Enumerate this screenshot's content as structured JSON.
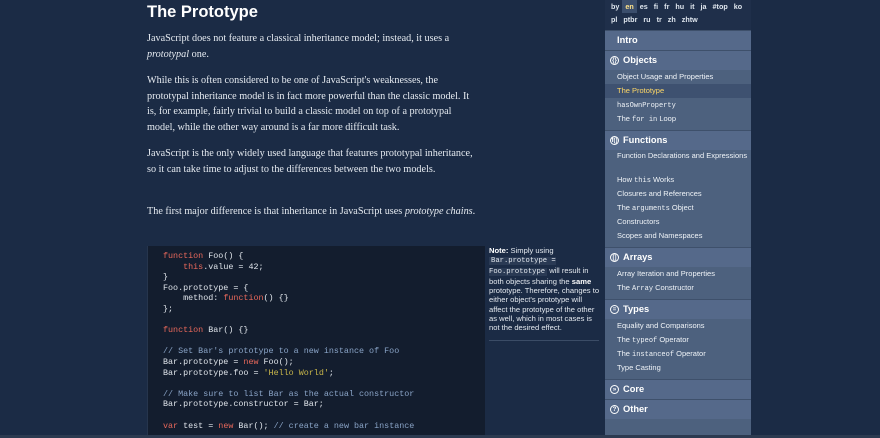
{
  "article": {
    "title": "The Prototype",
    "p1": [
      "JavaScript does not feature a classical inheritance model; instead, it uses a ",
      "prototypal",
      " one."
    ],
    "p2": "While this is often considered to be one of JavaScript's weaknesses, the prototypal inheritance model is in fact more powerful than the classic model. It is, for example, fairly trivial to build a classic model on top of a prototypal model, while the other way around is a far more difficult task.",
    "p3": "JavaScript is the only widely used language that features prototypal inheritance, so it can take time to adjust to the differences between the two models.",
    "p4": [
      "The first major difference is that inheritance in JavaScript uses ",
      "prototype chains",
      "."
    ]
  },
  "code_lines": [
    "function Foo() {",
    "    this.value = 42;",
    "}",
    "Foo.prototype = {",
    "    method: function() {}",
    "};",
    "",
    "function Bar() {}",
    "",
    "// Set Bar's prototype to a new instance of Foo",
    "Bar.prototype = new Foo();",
    "Bar.prototype.foo = 'Hello World';",
    "",
    "// Make sure to list Bar as the actual constructor",
    "Bar.prototype.constructor = Bar;",
    "",
    "var test = new Bar(); // create a new bar instance"
  ],
  "note": {
    "label": "Note:",
    "t1": " Simply using ",
    "c1": "Bar.prototype = Foo.prototype",
    "t2": " will result in both objects sharing the ",
    "b1": "same",
    "t3": " prototype. Therefore, changes to either object's prototype will affect the prototype of the other as well, which in most cases is not the desired effect."
  },
  "nav": {
    "languages": [
      "by",
      "en",
      "es",
      "fi",
      "fr",
      "hu",
      "it",
      "ja",
      "#top",
      "ko",
      "pl",
      "ptbr",
      "ru",
      "tr",
      "zh",
      "zhtw"
    ],
    "active_language": "en",
    "intro": "Intro",
    "sections": [
      {
        "title": "Objects",
        "icon": "objects-icon",
        "glyph": "{}",
        "items": [
          {
            "label": "Object Usage and Properties"
          },
          {
            "label": "The Prototype",
            "active": true
          },
          {
            "label": "hasOwnProperty",
            "mono": true
          },
          {
            "label_pre": "The ",
            "label_code": "for in",
            "label_post": " Loop"
          }
        ]
      },
      {
        "title": "Functions",
        "icon": "functions-icon",
        "glyph": "f()",
        "items": [
          {
            "label": "Function Declarations and Expressions",
            "two": true
          },
          {
            "label_pre": "How ",
            "label_code": "this",
            "label_post": " Works"
          },
          {
            "label": "Closures and References"
          },
          {
            "label_pre": "The ",
            "label_code": "arguments",
            "label_post": " Object"
          },
          {
            "label": "Constructors"
          },
          {
            "label": "Scopes and Namespaces"
          }
        ]
      },
      {
        "title": "Arrays",
        "icon": "arrays-icon",
        "glyph": "[]",
        "items": [
          {
            "label": "Array Iteration and Properties"
          },
          {
            "label_pre": "The ",
            "label_code": "Array",
            "label_post": " Constructor"
          }
        ]
      },
      {
        "title": "Types",
        "icon": "types-icon",
        "glyph": "=",
        "items": [
          {
            "label": "Equality and Comparisons"
          },
          {
            "label_pre": "The ",
            "label_code": "typeof",
            "label_post": " Operator"
          },
          {
            "label_pre": "The ",
            "label_code": "instanceof",
            "label_post": " Operator"
          },
          {
            "label": "Type Casting"
          }
        ]
      },
      {
        "title": "Core",
        "icon": "core-icon",
        "glyph": "»",
        "items": []
      },
      {
        "title": "Other",
        "icon": "other-icon",
        "glyph": "?",
        "items": []
      }
    ]
  },
  "colors": {
    "background": "#1b2b45",
    "nav": "#4d617e",
    "active": "#ffd866",
    "keyword": "#e8685b",
    "string": "#c8b64a"
  }
}
